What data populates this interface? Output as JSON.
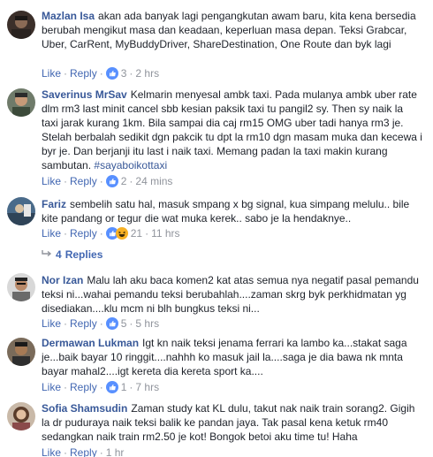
{
  "comments": [
    {
      "author": "Mazlan Isa",
      "text": "akan ada banyak lagi pengangkutan awam baru, kita kena bersedia berubah mengikut masa dan keadaan, keperluan masa depan. Teksi Grabcar, Uber, CarRent, MyBuddyDriver, ShareDestination, One Route dan byk lagi",
      "like": "Like",
      "reply": "Reply",
      "reaction_count": "3",
      "time": "2 hrs",
      "reactions": [
        "like-icon"
      ]
    },
    {
      "author": "Saverinus MrSav",
      "text": "Kelmarin menyesal ambk taxi. Pada mulanya ambk uber rate dlm rm3 last minit cancel sbb kesian paksik taxi tu pangil2 sy. Then sy naik la taxi jarak kurang 1km. Bila sampai dia caj rm15 OMG uber tadi hanya rm3 je. Stelah berbalah sedikit dgn pakcik tu dpt la rm10 dgn masam muka dan kecewa i byr je. Dan berjanji itu last i naik taxi. Memang padan la taxi makin kurang sambutan.",
      "hashtag": "#sayaboikottaxi",
      "like": "Like",
      "reply": "Reply",
      "reaction_count": "2",
      "time": "24 mins",
      "reactions": [
        "like-icon"
      ]
    },
    {
      "author": "Fariz",
      "text": "sembelih satu hal, masuk smpang x bg signal, kua simpang melulu.. bile kite pandang or tegur die wat muka kerek.. sabo je la hendaknye..",
      "like": "Like",
      "reply": "Reply",
      "reaction_count": "21",
      "time": "11 hrs",
      "reactions": [
        "like-icon",
        "haha-icon"
      ]
    },
    {
      "author": "Nor Izan",
      "text": "Malu lah aku baca komen2 kat atas semua nya negatif pasal pemandu teksi ni...wahai pemandu teksi berubahlah....zaman skrg byk perkhidmatan yg disediakan....klu mcm ni blh bungkus teksi ni...",
      "like": "Like",
      "reply": "Reply",
      "reaction_count": "5",
      "time": "5 hrs",
      "reactions": [
        "like-icon"
      ]
    },
    {
      "author": "Dermawan Lukman",
      "text": "Igt kn naik teksi jenama ferrari ka lambo ka...stakat saga je...baik bayar 10 ringgit....nahhh ko masuk jail la....saga je dia bawa nk mnta bayar mahal2....igt kereta dia kereta sport ka....",
      "like": "Like",
      "reply": "Reply",
      "reaction_count": "1",
      "time": "7 hrs",
      "reactions": [
        "like-icon"
      ]
    },
    {
      "author": "Sofia Shamsudin",
      "text": "Zaman study kat KL dulu, takut nak naik train sorang2. Gigih la dr puduraya naik teksi balik ke pandan jaya. Tak pasal kena ketuk rm40 sedangkan naik train rm2.50 je kot! Bongok betoi aku time tu! Haha",
      "like": "Like",
      "reply": "Reply",
      "time": "1 hr"
    }
  ],
  "replies_link": {
    "count": "4",
    "label": "Replies"
  },
  "colors": {
    "author": "#385898",
    "link": "#4267b2",
    "meta": "#90949c",
    "text": "#1d2129",
    "like_icon_bg": "#5890ff",
    "haha_icon_bg": "#f7b125"
  }
}
